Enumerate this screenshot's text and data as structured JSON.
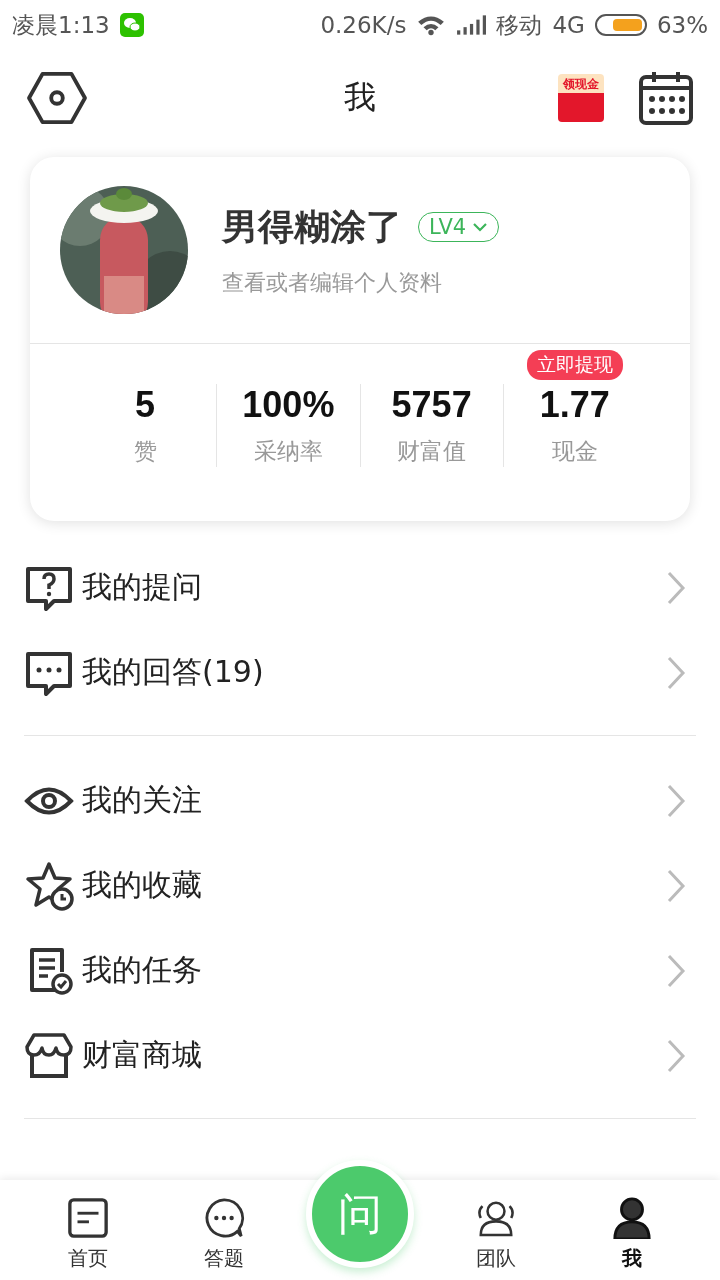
{
  "status_bar": {
    "time": "凌晨1:13",
    "speed": "0.26K/s",
    "carrier": "移动",
    "network": "4G",
    "battery": "63%"
  },
  "header": {
    "title": "我",
    "promo": "领现金"
  },
  "profile": {
    "name": "男得糊涂了",
    "level": "LV4",
    "subtitle": "查看或者编辑个人资料"
  },
  "stats": [
    {
      "value": "5",
      "label": "赞"
    },
    {
      "value": "100%",
      "label": "采纳率"
    },
    {
      "value": "5757",
      "label": "财富值"
    },
    {
      "value": "1.77",
      "label": "现金",
      "badge": "立即提现"
    }
  ],
  "menu_groups": [
    [
      {
        "kind": "question",
        "label": "我的提问"
      },
      {
        "kind": "chat",
        "label": "我的回答(19)"
      }
    ],
    [
      {
        "kind": "eye",
        "label": "我的关注"
      },
      {
        "kind": "star",
        "label": "我的收藏"
      },
      {
        "kind": "task",
        "label": "我的任务"
      },
      {
        "kind": "shop",
        "label": "财富商城"
      }
    ]
  ],
  "bottom_nav": [
    {
      "kind": "home",
      "label": "首页",
      "selected": false
    },
    {
      "kind": "chat",
      "label": "答题",
      "selected": false
    },
    {
      "kind": "ask",
      "label": "问",
      "selected": false
    },
    {
      "kind": "team",
      "label": "团队",
      "selected": false
    },
    {
      "kind": "me",
      "label": "我",
      "selected": true
    }
  ]
}
